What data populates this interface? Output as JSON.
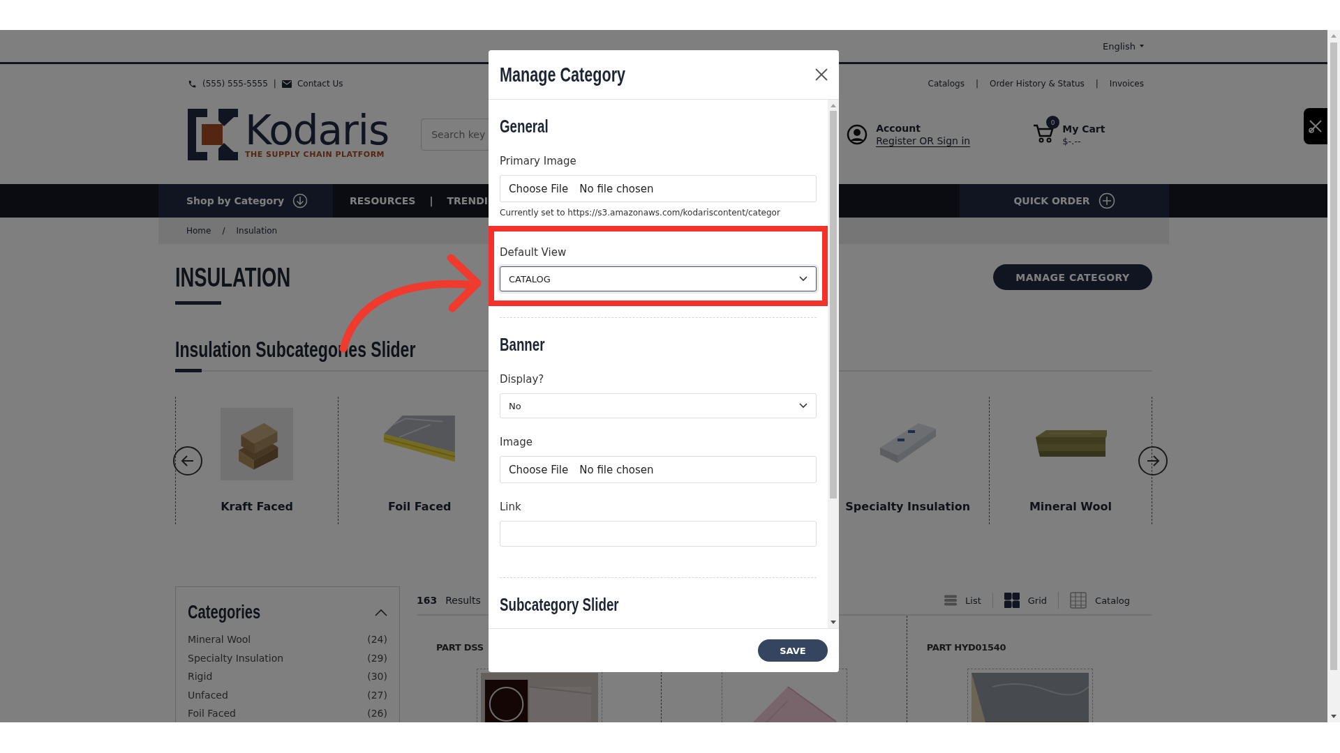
{
  "language": "English",
  "contact": {
    "phone": "(555) 555-5555",
    "separator": "|",
    "email": "Contact Us"
  },
  "top_links": {
    "separator": "|",
    "items": [
      "Catalogs",
      "Order History & Status",
      "Invoices"
    ]
  },
  "logo": {
    "name": "Kodaris",
    "tagline": "THE SUPPLY CHAIN PLATFORM"
  },
  "search": {
    "placeholder": "Search key"
  },
  "account": {
    "title": "Account",
    "link": "Register OR Sign in"
  },
  "cart": {
    "title": "My Cart",
    "total": "$-.--",
    "count": "0"
  },
  "nav": {
    "shop": "Shop by Category",
    "separator": "|",
    "links": [
      "RESOURCES",
      "TRENDI"
    ],
    "quick_order": "QUICK ORDER"
  },
  "breadcrumb": {
    "separator": "/",
    "items": [
      "Home",
      "Insulation"
    ]
  },
  "page_title": "INSULATION",
  "manage_button": "MANAGE CATEGORY",
  "slider": {
    "title": "Insulation Subcategories Slider",
    "items": [
      {
        "label": "Kraft Faced",
        "kind": "kraft"
      },
      {
        "label": "Foil Faced",
        "kind": "foil"
      },
      {
        "label": "Specialty Insulation",
        "kind": "board"
      },
      {
        "label": "Mineral Wool",
        "kind": "wool"
      }
    ]
  },
  "categories": {
    "title": "Categories",
    "expanded": true,
    "items": [
      {
        "name": "Mineral Wool",
        "count": "(24)"
      },
      {
        "name": "Specialty Insulation",
        "count": "(29)"
      },
      {
        "name": "Rigid",
        "count": "(30)"
      },
      {
        "name": "Unfaced",
        "count": "(27)"
      },
      {
        "name": "Foil Faced",
        "count": "(26)"
      }
    ]
  },
  "results": {
    "count": "163",
    "label": "Results"
  },
  "views": [
    {
      "label": "List",
      "kind": "list",
      "selected": false
    },
    {
      "label": "Grid",
      "kind": "grid",
      "selected": true
    },
    {
      "label": "Catalog",
      "kind": "table",
      "selected": false
    }
  ],
  "parts": [
    {
      "label": "PART DSS",
      "kind": "box"
    },
    {
      "kind": "sheet"
    },
    {
      "label": "PART HYD01540",
      "kind": "foilwool"
    }
  ],
  "modal": {
    "title": "Manage Category",
    "save": "SAVE",
    "sections": [
      {
        "title": "General",
        "fields": [
          {
            "kind": "file",
            "label": "Primary Image",
            "button": "Choose File",
            "value": "No file chosen",
            "note": "Currently set to https://s3.amazonaws.com/kodariscontent/categor"
          },
          {
            "kind": "select",
            "label": "Default View",
            "value": "CATALOG",
            "focused": true,
            "highlighted": true
          }
        ]
      },
      {
        "title": "Banner",
        "fields": [
          {
            "kind": "select",
            "label": "Display?",
            "value": "No",
            "focused": false,
            "highlighted": false
          },
          {
            "kind": "file",
            "label": "Image",
            "button": "Choose File",
            "value": "No file chosen"
          },
          {
            "kind": "text",
            "label": "Link"
          }
        ]
      },
      {
        "title": "Subcategory Slider"
      }
    ]
  },
  "annotation": {
    "arrow": true
  }
}
